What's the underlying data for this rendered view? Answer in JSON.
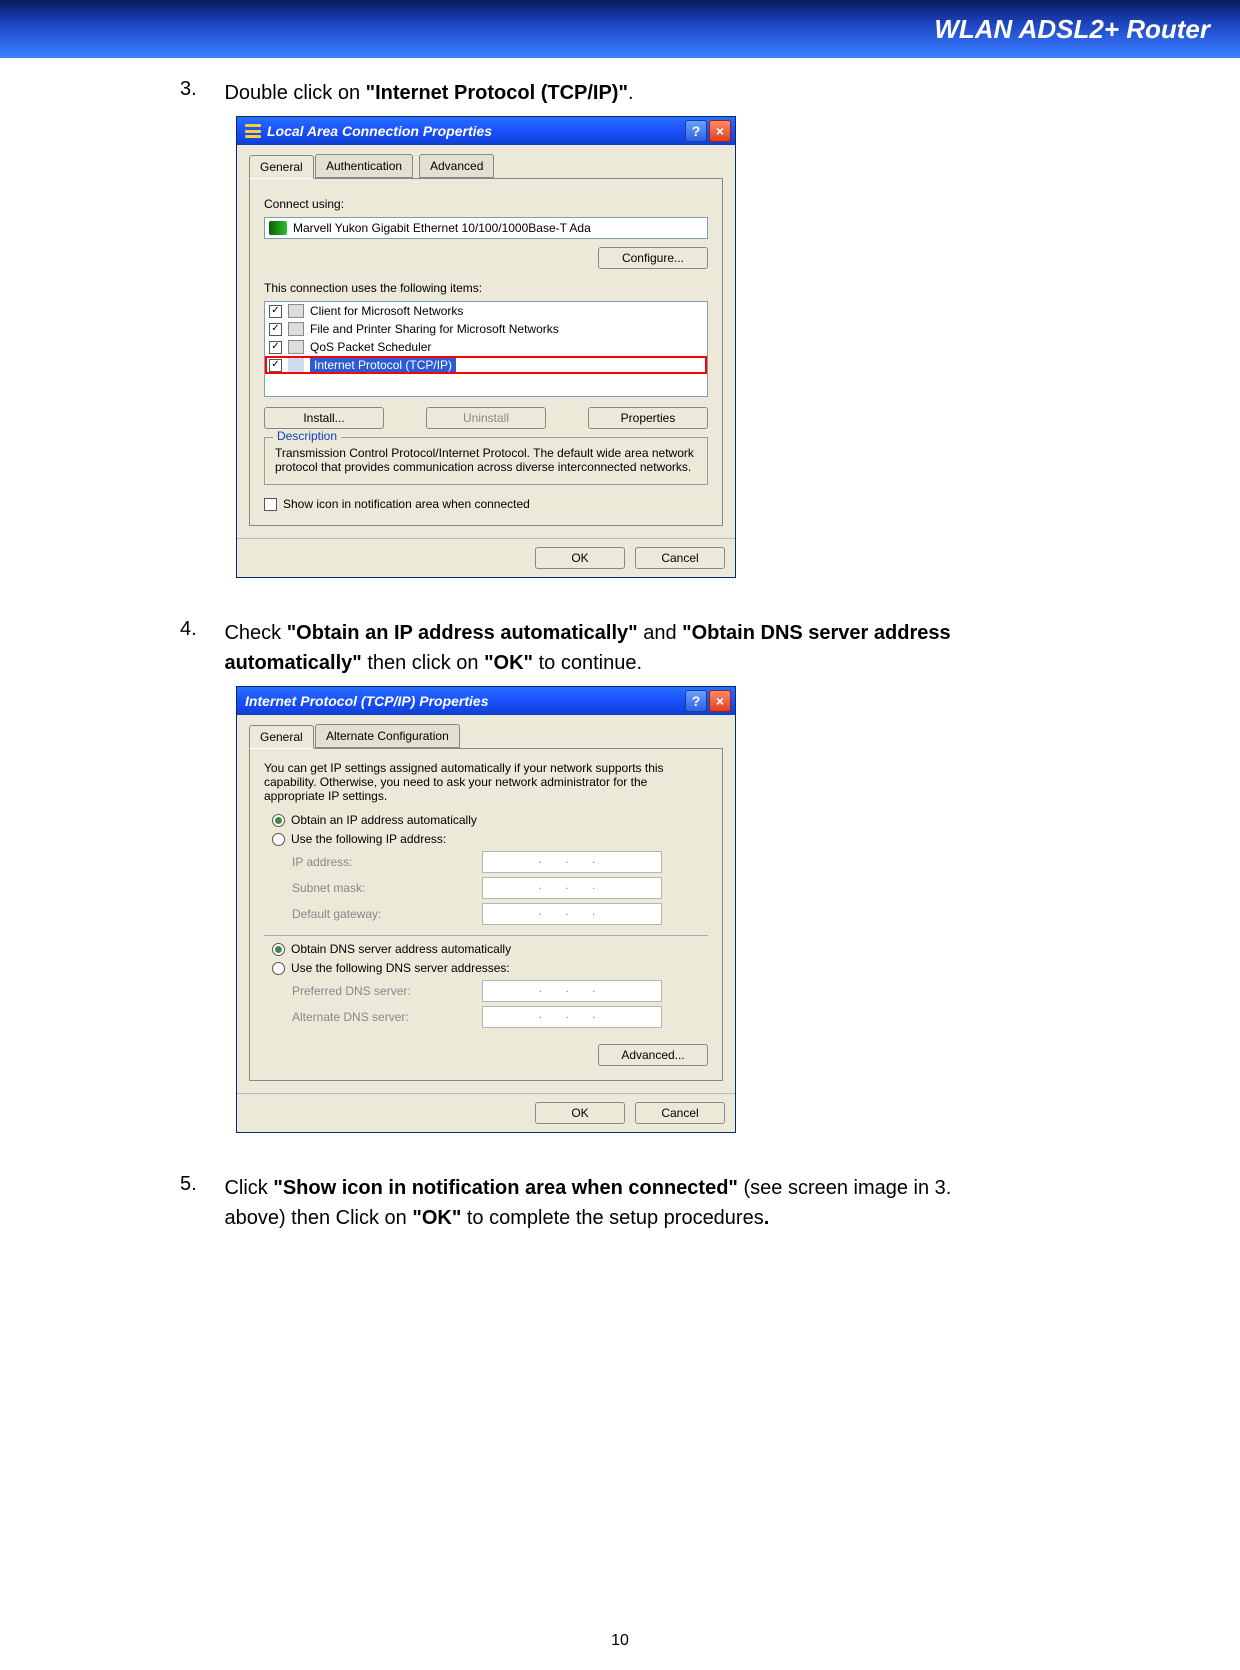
{
  "header": {
    "title": "WLAN ADSL2+ Router"
  },
  "steps": {
    "s3": {
      "num": "3.",
      "t1": "Double click on ",
      "b1": "\"Internet Protocol (TCP/IP)\"",
      "t2": "."
    },
    "s4": {
      "num": "4.",
      "t1": "Check ",
      "b1": "\"Obtain an IP address automatically\"",
      "t2": " and ",
      "b2": "\"Obtain DNS server address automatically\"",
      "t3": " then click on ",
      "b3": "\"OK\"",
      "t4": " to continue."
    },
    "s5": {
      "num": "5.",
      "t1": "Click ",
      "b1": "\"Show icon in notification area when connected\"",
      "t2": " (see screen image in 3. above) then Click on ",
      "b2": "\"OK\"",
      "t3": " to complete the setup procedures",
      "b3": "."
    }
  },
  "dlg1": {
    "title": "Local Area Connection Properties",
    "tabs": [
      "General",
      "Authentication",
      "Advanced"
    ],
    "connect_using_label": "Connect using:",
    "adapter": "Marvell Yukon Gigabit Ethernet 10/100/1000Base-T Ada",
    "configure": "Configure...",
    "items_label": "This connection uses the following items:",
    "items": [
      "Client for Microsoft Networks",
      "File and Printer Sharing for Microsoft Networks",
      "QoS Packet Scheduler",
      "Internet Protocol (TCP/IP)"
    ],
    "install": "Install...",
    "uninstall": "Uninstall",
    "properties": "Properties",
    "desc_legend": "Description",
    "desc": "Transmission Control Protocol/Internet Protocol. The default wide area network protocol that provides communication across diverse interconnected networks.",
    "show_icon": "Show icon in notification area when connected",
    "ok": "OK",
    "cancel": "Cancel"
  },
  "dlg2": {
    "title": "Internet Protocol (TCP/IP) Properties",
    "tabs": [
      "General",
      "Alternate Configuration"
    ],
    "intro": "You can get IP settings assigned automatically if your network supports this capability. Otherwise, you need to ask your network administrator for the appropriate IP settings.",
    "r1": "Obtain an IP address automatically",
    "r2": "Use the following IP address:",
    "ip": "IP address:",
    "mask": "Subnet mask:",
    "gw": "Default gateway:",
    "r3": "Obtain DNS server address automatically",
    "r4": "Use the following DNS server addresses:",
    "pdns": "Preferred DNS server:",
    "adns": "Alternate DNS server:",
    "dots": ".     .     .",
    "advanced": "Advanced...",
    "ok": "OK",
    "cancel": "Cancel"
  },
  "page_number": "10"
}
